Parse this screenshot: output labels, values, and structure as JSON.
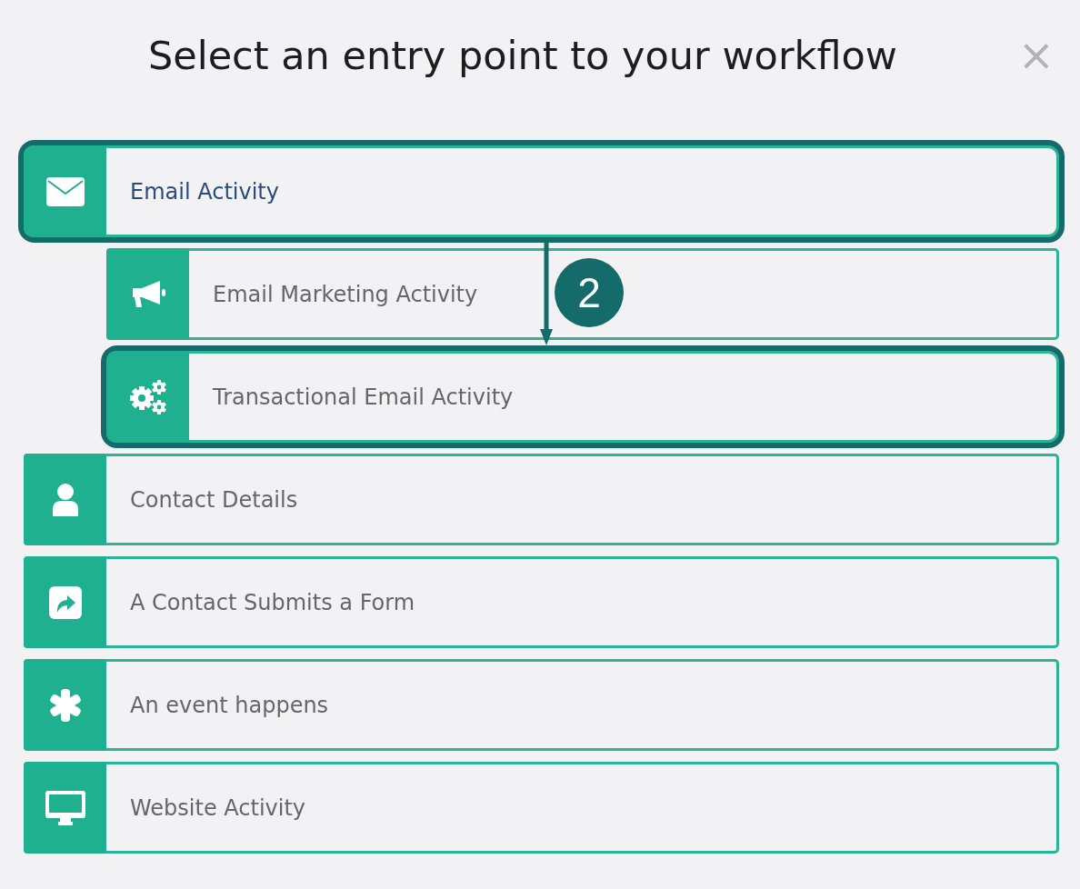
{
  "dialog": {
    "title": "Select an entry point to your workflow",
    "close": "×"
  },
  "options": [
    {
      "kind": "envelope",
      "label": "Email Activity",
      "selected": true,
      "highlighted": true,
      "children": [
        {
          "kind": "megaphone",
          "label": "Email Marketing Activity",
          "selected": false,
          "highlighted": false
        },
        {
          "kind": "gears",
          "label": "Transactional Email Activity",
          "selected": false,
          "highlighted": true
        }
      ]
    },
    {
      "kind": "user",
      "label": "Contact Details",
      "selected": false,
      "highlighted": false
    },
    {
      "kind": "share",
      "label": "A Contact Submits a Form",
      "selected": false,
      "highlighted": false
    },
    {
      "kind": "asterisk",
      "label": "An event happens",
      "selected": false,
      "highlighted": false
    },
    {
      "kind": "monitor",
      "label": "Website Activity",
      "selected": false,
      "highlighted": false
    }
  ],
  "callout": {
    "number": "2"
  }
}
